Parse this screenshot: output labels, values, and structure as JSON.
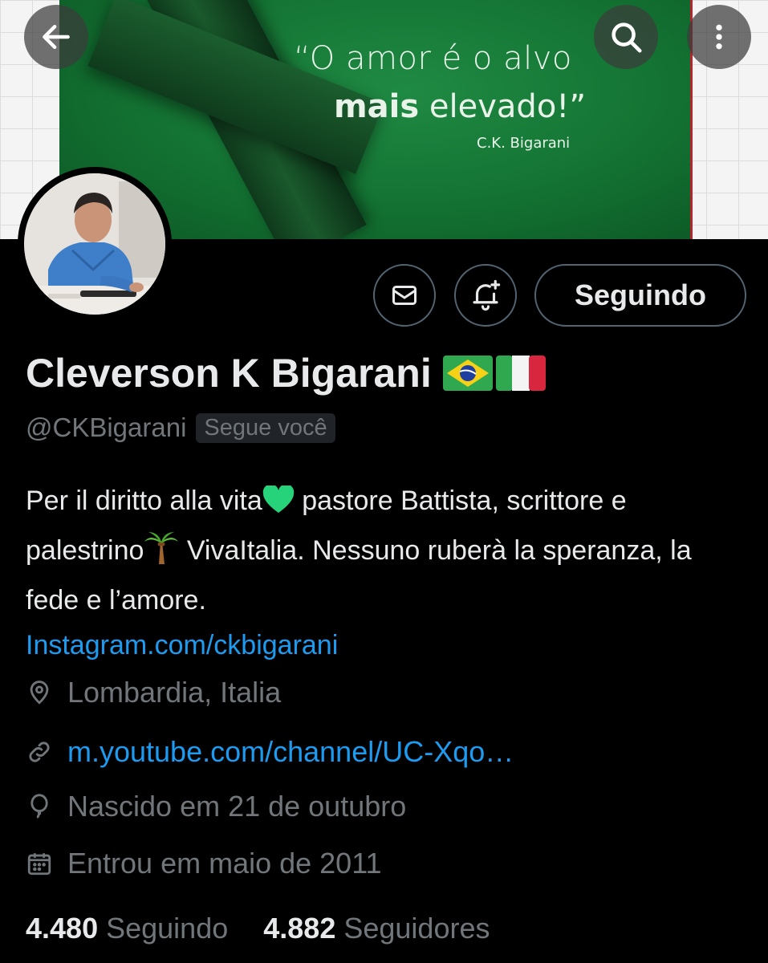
{
  "banner": {
    "quote_line1": "“O amor é o alvo",
    "quote_line2_bold": "mais",
    "quote_line2_rest": " elevado!”",
    "quote_author": "C.K. Bigarani"
  },
  "header": {
    "back_icon": "arrow-left-icon",
    "search_icon": "search-icon",
    "more_icon": "more-vertical-icon"
  },
  "actions": {
    "message_icon": "envelope-icon",
    "notify_icon": "bell-plus-icon",
    "follow_label": "Seguindo"
  },
  "profile": {
    "name": "Cleverson K Bigarani",
    "flags": [
      "brazil-flag",
      "italy-flag"
    ],
    "handle": "@CKBigarani",
    "follows_you": "Segue você",
    "bio_part1": "Per il diritto alla vita",
    "bio_part2": " pastore Battista, scrittore e palestrino",
    "bio_part3": " VivaItalia. Nessuno ruberà la speranza, la fede e l’amore.",
    "bio_emojis": [
      "green-heart-icon",
      "palm-tree-icon"
    ],
    "bio_link": "Instagram.com/ckbigarani",
    "location": "Lombardia, Italia",
    "website": "m.youtube.com/channel/UC-Xqo…",
    "birthday": "Nascido em 21 de outubro",
    "joined": "Entrou em maio de 2011",
    "following_count": "4.480",
    "following_label": "Seguindo",
    "followers_count": "4.882",
    "followers_label": "Seguidores"
  },
  "colors": {
    "background": "#000000",
    "text": "#e7e9ea",
    "muted": "#71767b",
    "link": "#1d9bf0",
    "border": "#536471",
    "banner_green": "#137232"
  }
}
